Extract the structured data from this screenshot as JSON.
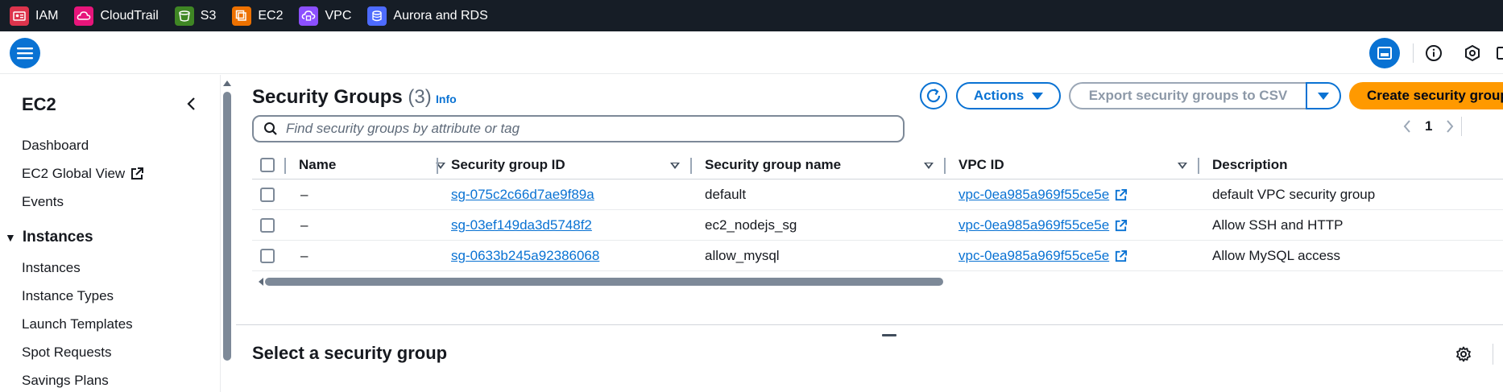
{
  "topbar": {
    "services": [
      {
        "label": "IAM",
        "icon": "iam-icon",
        "color": "#dd344c"
      },
      {
        "label": "CloudTrail",
        "icon": "cloudtrail-icon",
        "color": "#e7157b"
      },
      {
        "label": "S3",
        "icon": "s3-icon",
        "color": "#3f8624"
      },
      {
        "label": "EC2",
        "icon": "ec2-icon",
        "color": "#ed7100"
      },
      {
        "label": "VPC",
        "icon": "vpc-icon",
        "color": "#8c4fff"
      },
      {
        "label": "Aurora and RDS",
        "icon": "rds-icon",
        "color": "#4d6bfe"
      }
    ]
  },
  "sidebar": {
    "title": "EC2",
    "links": [
      {
        "label": "Dashboard"
      },
      {
        "label": "EC2 Global View"
      },
      {
        "label": "Events"
      }
    ],
    "section": {
      "label": "Instances"
    },
    "section_items": [
      {
        "label": "Instances"
      },
      {
        "label": "Instance Types"
      },
      {
        "label": "Launch Templates"
      },
      {
        "label": "Spot Requests"
      },
      {
        "label": "Savings Plans"
      }
    ]
  },
  "main": {
    "title": "Security Groups",
    "count": "(3)",
    "info": "Info",
    "actions_label": "Actions",
    "export_label": "Export security groups to CSV",
    "create_label": "Create security group",
    "search_placeholder": "Find security groups by attribute or tag",
    "page": "1"
  },
  "table": {
    "columns": [
      "Name",
      "Security group ID",
      "Security group name",
      "VPC ID",
      "Description"
    ],
    "rows": [
      {
        "name": "–",
        "sg_id": "sg-075c2c66d7ae9f89a",
        "sg_name": "default",
        "vpc_id": "vpc-0ea985a969f55ce5e",
        "description": "default VPC security group"
      },
      {
        "name": "–",
        "sg_id": "sg-03ef149da3d5748f2",
        "sg_name": "ec2_nodejs_sg",
        "vpc_id": "vpc-0ea985a969f55ce5e",
        "description": "Allow SSH and HTTP"
      },
      {
        "name": "–",
        "sg_id": "sg-0633b245a92386068",
        "sg_name": "allow_mysql",
        "vpc_id": "vpc-0ea985a969f55ce5e",
        "description": "Allow MySQL access"
      }
    ]
  },
  "detail": {
    "title": "Select a security group"
  },
  "colors": {
    "accent": "#0972d3",
    "primary_button": "#ff9900",
    "topbar_bg": "#161d26"
  }
}
